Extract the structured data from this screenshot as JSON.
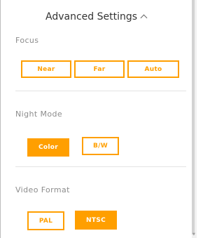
{
  "panel": {
    "title": "Advanced Settings",
    "toggle_icon": "chevron-up-icon"
  },
  "sections": {
    "focus": {
      "label": "Focus",
      "options": [
        "Near",
        "Far",
        "Auto"
      ],
      "selected": null
    },
    "night_mode": {
      "label": "Night Mode",
      "options": [
        "Color",
        "B/W"
      ],
      "selected": "Color"
    },
    "video_format": {
      "label": "Video Format",
      "options": [
        "PAL",
        "NTSC"
      ],
      "selected": "NTSC"
    }
  },
  "colors": {
    "accent": "#ff9f00",
    "label": "#8c8c8c",
    "title": "#333333",
    "divider": "#e3e3e3"
  }
}
